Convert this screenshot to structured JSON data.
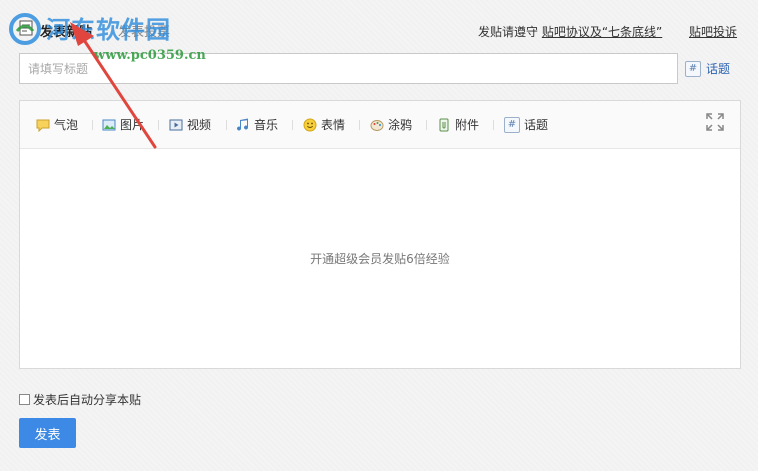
{
  "header": {
    "title": "发表新贴",
    "sub_tab": "发表投票",
    "rule_prefix": "发贴请遵守 ",
    "rule_link": "贴吧协议及“七条底线”",
    "report_link": "贴吧投诉"
  },
  "title_input": {
    "placeholder": "请填写标题",
    "value": ""
  },
  "topic_button": {
    "label": "话题",
    "icon": "hash-icon"
  },
  "toolbar": {
    "items": [
      {
        "label": "气泡",
        "icon": "bubble-icon"
      },
      {
        "label": "图片",
        "icon": "image-icon"
      },
      {
        "label": "视频",
        "icon": "video-icon"
      },
      {
        "label": "音乐",
        "icon": "music-icon"
      },
      {
        "label": "表情",
        "icon": "smiley-icon"
      },
      {
        "label": "涂鸦",
        "icon": "palette-icon"
      },
      {
        "label": "附件",
        "icon": "paperclip-icon"
      },
      {
        "label": "话题",
        "icon": "hash-icon"
      }
    ],
    "fullscreen_icon": "fullscreen-icon"
  },
  "editor": {
    "hint": "开通超级会员发贴6倍经验"
  },
  "share_checkbox": {
    "label": "发表后自动分享本贴",
    "checked": false
  },
  "submit_button": {
    "label": "发表"
  },
  "watermark": {
    "text": "河东软件园",
    "url": "www.pc0359.cn"
  },
  "colors": {
    "accent": "#3d89e6",
    "link": "#2d64b3",
    "watermark_blue": "#2f8ede",
    "watermark_green": "#2a9a3a",
    "arrow": "#e0453e"
  }
}
